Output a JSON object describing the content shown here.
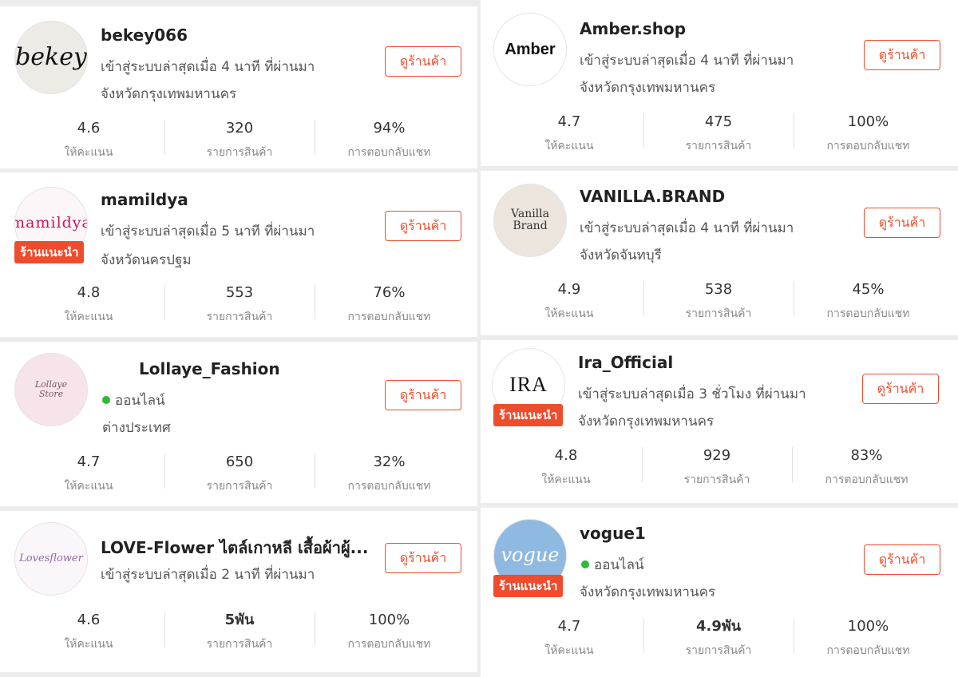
{
  "ui": {
    "view_shop": "ดูร้านค้า",
    "recommended": "ร้านแนะนำ"
  },
  "stat_labels": {
    "rating": "ให้คะแนน",
    "products": "รายการสินค้า",
    "chat": "การตอบกลับแชท"
  },
  "shops": [
    {
      "name": "bekey066",
      "status": "เข้าสู่ระบบล่าสุดเมื่อ 4 นาที ที่ผ่านมา",
      "location": "จังหวัดกรุงเทพมหานคร",
      "rating": "4.6",
      "products": "320",
      "chat": "94%"
    },
    {
      "name": "mamildya",
      "status": "เข้าสู่ระบบล่าสุดเมื่อ 5 นาที ที่ผ่านมา",
      "location": "จังหวัดนครปฐม",
      "rating": "4.8",
      "products": "553",
      "chat": "76%"
    },
    {
      "name": "Lollaye_Fashion",
      "status": "ออนไลน์",
      "location": "ต่างประเทศ",
      "rating": "4.7",
      "products": "650",
      "chat": "32%"
    },
    {
      "name": "LOVE-Flower ไตล์เกาหลี เสื้อผ้าผู้...",
      "status": "เข้าสู่ระบบล่าสุดเมื่อ 2 นาที ที่ผ่านมา",
      "location": "",
      "rating": "4.6",
      "products": "5พัน",
      "chat": "100%"
    },
    {
      "name": "Amber.shop",
      "status": "เข้าสู่ระบบล่าสุดเมื่อ 4 นาที ที่ผ่านมา",
      "location": "จังหวัดกรุงเทพมหานคร",
      "rating": "4.7",
      "products": "475",
      "chat": "100%"
    },
    {
      "name": "VANILLA.BRAND",
      "status": "เข้าสู่ระบบล่าสุดเมื่อ 4 นาที ที่ผ่านมา",
      "location": "จังหวัดจันทบุรี",
      "rating": "4.9",
      "products": "538",
      "chat": "45%"
    },
    {
      "name": "Ira_Official",
      "status": "เข้าสู่ระบบล่าสุดเมื่อ 3 ชั่วโมง ที่ผ่านมา",
      "location": "จังหวัดกรุงเทพมหานคร",
      "rating": "4.8",
      "products": "929",
      "chat": "83%"
    },
    {
      "name": "vogue1",
      "status": "ออนไลน์",
      "location": "จังหวัดกรุงเทพมหานคร",
      "rating": "4.7",
      "products": "4.9พัน",
      "chat": "100%"
    }
  ],
  "logos": {
    "bekey": "bekey",
    "mamildya": "mamildya",
    "lollaye": "Lollaye Store",
    "loveflower": "Lovesflower",
    "amber": "Amber",
    "vanilla_1": "Vanilla",
    "vanilla_2": "Brand",
    "ira": "IRA",
    "vogue": "vogue"
  },
  "colors": {
    "accent": "#ee4d2d",
    "online": "#2dba35"
  }
}
